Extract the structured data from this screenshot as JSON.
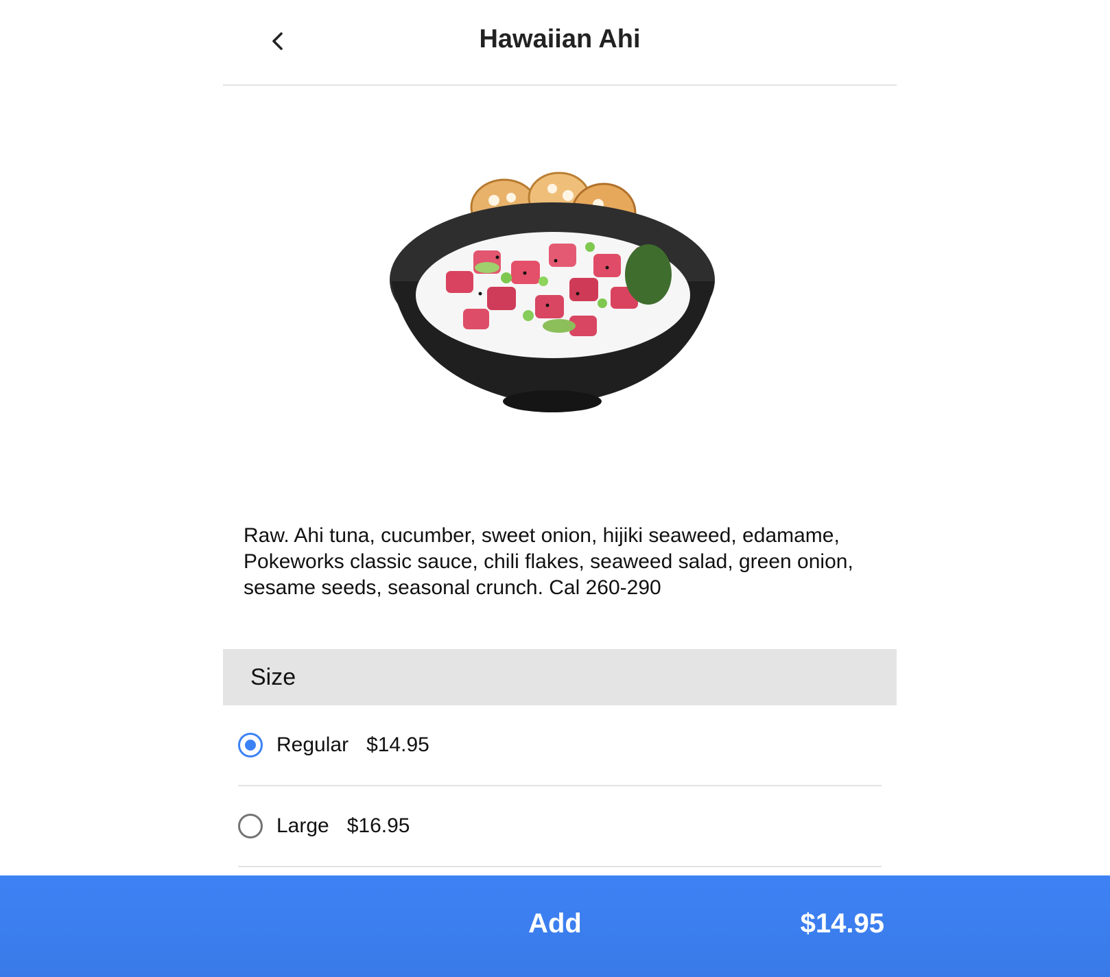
{
  "header": {
    "title": "Hawaiian Ahi",
    "back_icon": "chevron-left-icon"
  },
  "product": {
    "image": "poke-bowl-image",
    "description": "Raw. Ahi tuna, cucumber, sweet onion, hijiki seaweed, edamame, Pokeworks classic sauce, chili flakes, seaweed salad, green onion, sesame seeds, seasonal crunch. Cal 260-290"
  },
  "size_section": {
    "heading": "Size",
    "options": [
      {
        "label": "Regular",
        "price": "$14.95",
        "selected": true
      },
      {
        "label": "Large",
        "price": "$16.95",
        "selected": false
      }
    ]
  },
  "footer": {
    "add_label": "Add",
    "total": "$14.95"
  },
  "colors": {
    "accent": "#3b82f6",
    "section_bg": "#e4e4e4",
    "divider": "#e2e2e2"
  }
}
